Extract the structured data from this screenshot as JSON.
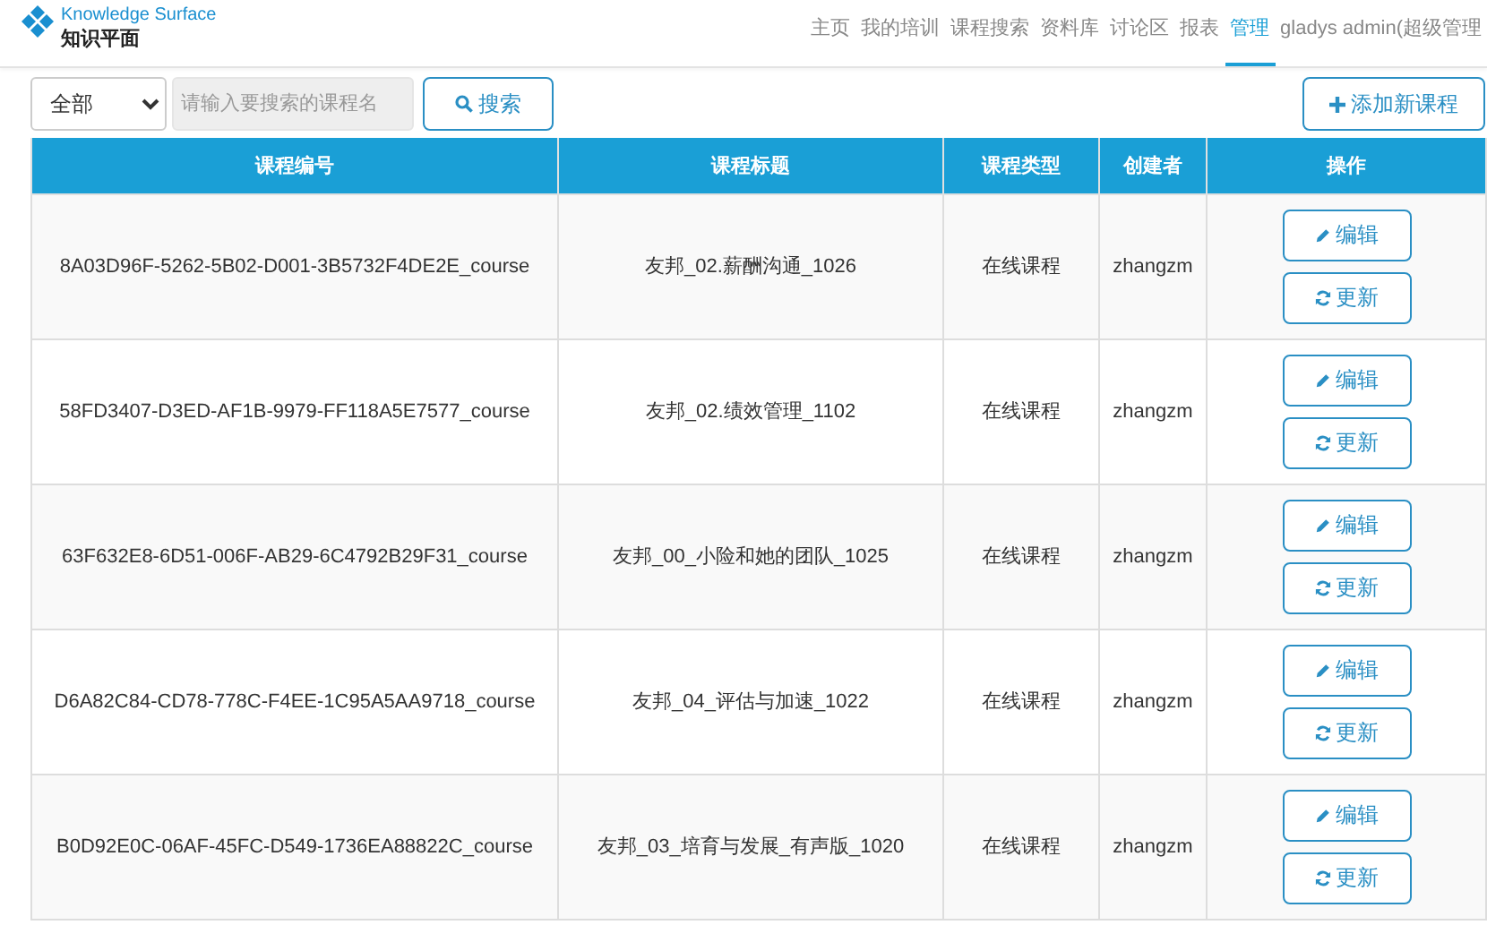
{
  "logo": {
    "name": "Knowledge Surface",
    "subtitle": "知识平面"
  },
  "nav": [
    {
      "label": "主页",
      "selected": false
    },
    {
      "label": "我的培训",
      "selected": false
    },
    {
      "label": "课程搜索",
      "selected": false
    },
    {
      "label": "资料库",
      "selected": false
    },
    {
      "label": "讨论区",
      "selected": false
    },
    {
      "label": "报表",
      "selected": false
    },
    {
      "label": "管理",
      "selected": true
    },
    {
      "label": "gladys admin(超级管理",
      "selected": false
    }
  ],
  "toolbar": {
    "filter": "全部",
    "search": {
      "placeholder": "请输入要搜索的课程名"
    },
    "search_button": "搜索",
    "add_button": "添加新课程"
  },
  "table": {
    "columns": [
      "课程编号",
      "课程标题",
      "课程类型",
      "创建者",
      "操作"
    ],
    "rows": [
      {
        "id": "8A03D96F-5262-5B02-D001-3B5732F4DE2E_course",
        "title": "友邦_02.薪酬沟通_1026",
        "type": "在线课程",
        "creator": "zhangzm",
        "actions": [
          "编辑",
          "更新"
        ]
      },
      {
        "id": "58FD3407-D3ED-AF1B-9979-FF118A5E7577_course",
        "title": "友邦_02.绩效管理_1102",
        "type": "在线课程",
        "creator": "zhangzm",
        "actions": [
          "编辑",
          "更新"
        ]
      },
      {
        "id": "63F632E8-6D51-006F-AB29-6C4792B29F31_course",
        "title": "友邦_00_小险和她的团队_1025",
        "type": "在线课程",
        "creator": "zhangzm",
        "actions": [
          "编辑",
          "更新"
        ]
      },
      {
        "id": "D6A82C84-CD78-778C-F4EE-1C95A5AA9718_course",
        "title": "友邦_04_评估与加速_1022",
        "type": "在线课程",
        "creator": "zhangzm",
        "actions": [
          "编辑",
          "更新"
        ]
      },
      {
        "id": "B0D92E0C-06AF-45FC-D549-1736EA88822C_course",
        "title": "友邦_03_培育与发展_有声版_1020",
        "type": "在线课程",
        "creator": "zhangzm",
        "actions": [
          "编辑",
          "更新"
        ]
      }
    ]
  }
}
